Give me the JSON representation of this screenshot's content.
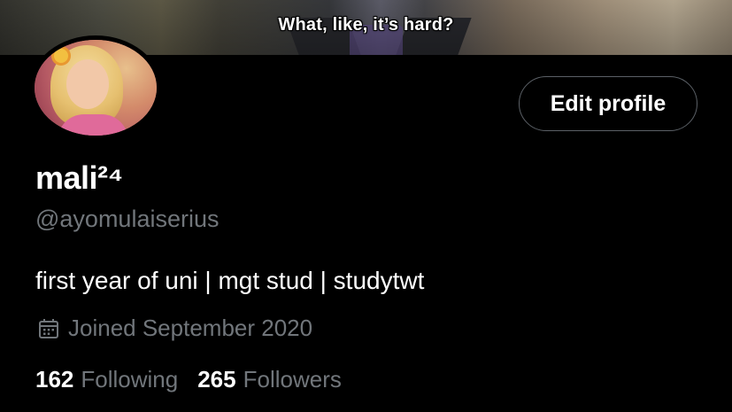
{
  "banner": {
    "subtitle": "What, like, it’s hard?"
  },
  "profile": {
    "display_name": "mali²⁴",
    "handle": "@ayomulaiserius",
    "bio": "first year of uni | mgt stud | studytwt",
    "joined": "Joined September 2020",
    "joined_icon": "calendar-icon"
  },
  "actions": {
    "edit_profile_label": "Edit profile"
  },
  "stats": {
    "following_count": "162",
    "following_label": "Following",
    "followers_count": "265",
    "followers_label": "Followers"
  },
  "colors": {
    "background": "#000000",
    "primary_text": "#ffffff",
    "secondary_text": "#71767b",
    "button_border": "#5b6066"
  }
}
